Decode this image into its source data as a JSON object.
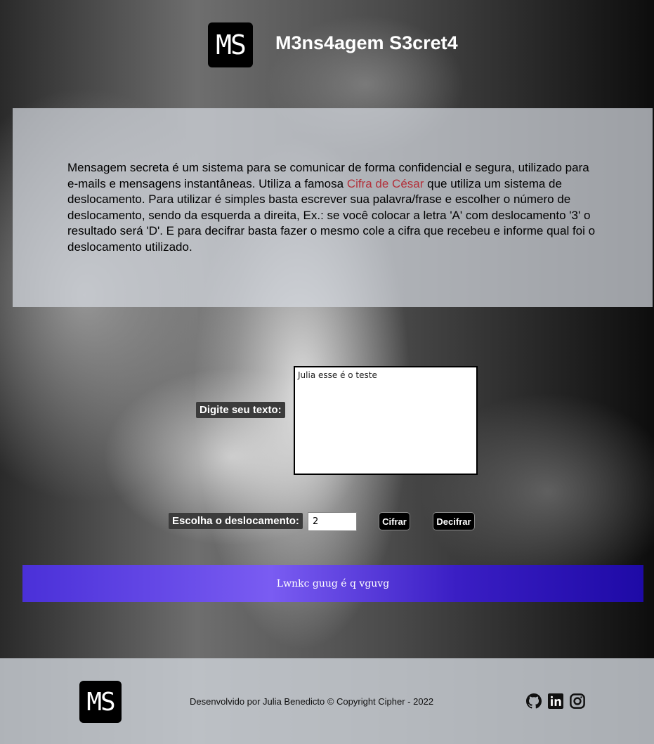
{
  "header": {
    "logo_text": "MS",
    "title": "M3ns4agem S3cret4"
  },
  "intro": {
    "text_before": "Mensagem secreta é um sistema para se comunicar de forma confidencial e segura, utilizado para e-mails e mensagens instantâneas. Utiliza a famosa ",
    "link_text": "Cifra de César",
    "text_after": " que utiliza um sistema de deslocamento. Para utilizar é simples basta escrever sua palavra/frase e escolher o número de deslocamento, sendo da esquerda a direita, Ex.: se você colocar a letra 'A' com deslocamento '3' o resultado será 'D'. E para decifrar basta fazer o mesmo cole a cifra que recebeu e informe qual foi o deslocamento utilizado."
  },
  "form": {
    "text_label": "Digite seu texto:",
    "text_value": "Julia esse é o teste",
    "shift_label": "Escolha o deslocamento:",
    "shift_value": "2",
    "cifrar_label": "Cifrar",
    "decifrar_label": "Decifrar"
  },
  "result": {
    "text": "Lwnkc guug é q vguvg"
  },
  "footer": {
    "logo_text": "MS",
    "copyright": "Desenvolvido por Julia Benedicto © Copyright Cipher - 2022",
    "social_icons": [
      "github-icon",
      "linkedin-icon",
      "instagram-icon"
    ]
  },
  "colors": {
    "link": "#b3303a",
    "result_gradient_start": "#4a30d8",
    "result_gradient_end": "#1e0aa6"
  }
}
